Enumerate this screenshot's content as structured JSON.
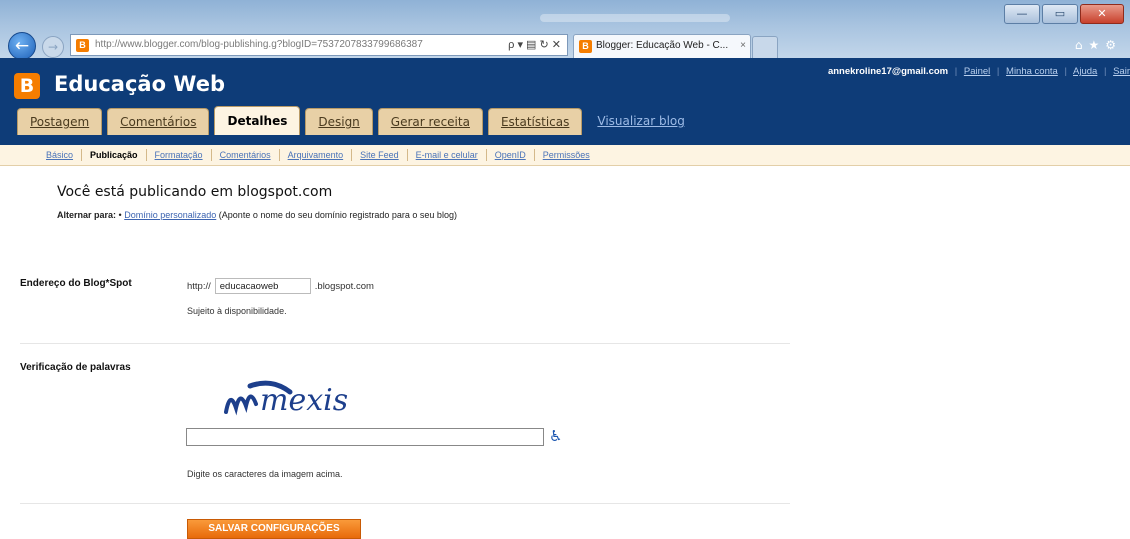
{
  "browser": {
    "address_url": "http://www.blogger.com/blog-publishing.g?blogID=7537207833799686387",
    "address_domain": "blogger.com",
    "search_arrow": "ρ ▾ ▤ ↻ ✕",
    "tab_title": "Blogger: Educação Web - C...",
    "tab_close": "×",
    "win_min": "—",
    "win_max": "▭",
    "win_close": "✕"
  },
  "header": {
    "logo_letter": "B",
    "blog_title": "Educação Web",
    "email": "annekroline17@gmail.com",
    "links": [
      "Painel",
      "Minha conta",
      "Ajuda",
      "Sair"
    ]
  },
  "tabs": [
    {
      "label": "Postagem",
      "active": false
    },
    {
      "label": "Comentários",
      "active": false
    },
    {
      "label": "Detalhes",
      "active": true
    },
    {
      "label": "Design",
      "active": false
    },
    {
      "label": "Gerar receita",
      "active": false
    },
    {
      "label": "Estatísticas",
      "active": false
    }
  ],
  "view_blog": "Visualizar blog",
  "subnav": [
    {
      "label": "Básico",
      "active": false
    },
    {
      "label": "Publicação",
      "active": true
    },
    {
      "label": "Formatação",
      "active": false
    },
    {
      "label": "Comentários",
      "active": false
    },
    {
      "label": "Arquivamento",
      "active": false
    },
    {
      "label": "Site Feed",
      "active": false
    },
    {
      "label": "E-mail e celular",
      "active": false
    },
    {
      "label": "OpenID",
      "active": false
    },
    {
      "label": "Permissões",
      "active": false
    }
  ],
  "main": {
    "heading": "Você está publicando em blogspot.com",
    "alt_label": "Alternar para:",
    "alt_bullet": "•",
    "alt_link": "Domínio personalizado",
    "alt_note": "(Aponte o nome do seu domínio registrado para o seu blog)",
    "blogspot_label": "Endereço do Blog*Spot",
    "url_prefix": "http://",
    "url_value": "educacaoweb",
    "url_suffix": ".blogspot.com",
    "availability": "Sujeito à disponibilidade.",
    "verification_label": "Verificação de palavras",
    "captcha_text": "mexis",
    "captcha_input_value": "",
    "captcha_hint": "Digite os caracteres da imagem acima.",
    "accessibility_icon": "wheelchair-icon",
    "save_label": "SALVAR CONFIGURAÇÕES"
  },
  "colors": {
    "header_bg": "#0e3c78",
    "brand_orange": "#f57d00",
    "tab_bg": "#e8d0a6",
    "active_tab_bg": "#fdf4e2"
  }
}
